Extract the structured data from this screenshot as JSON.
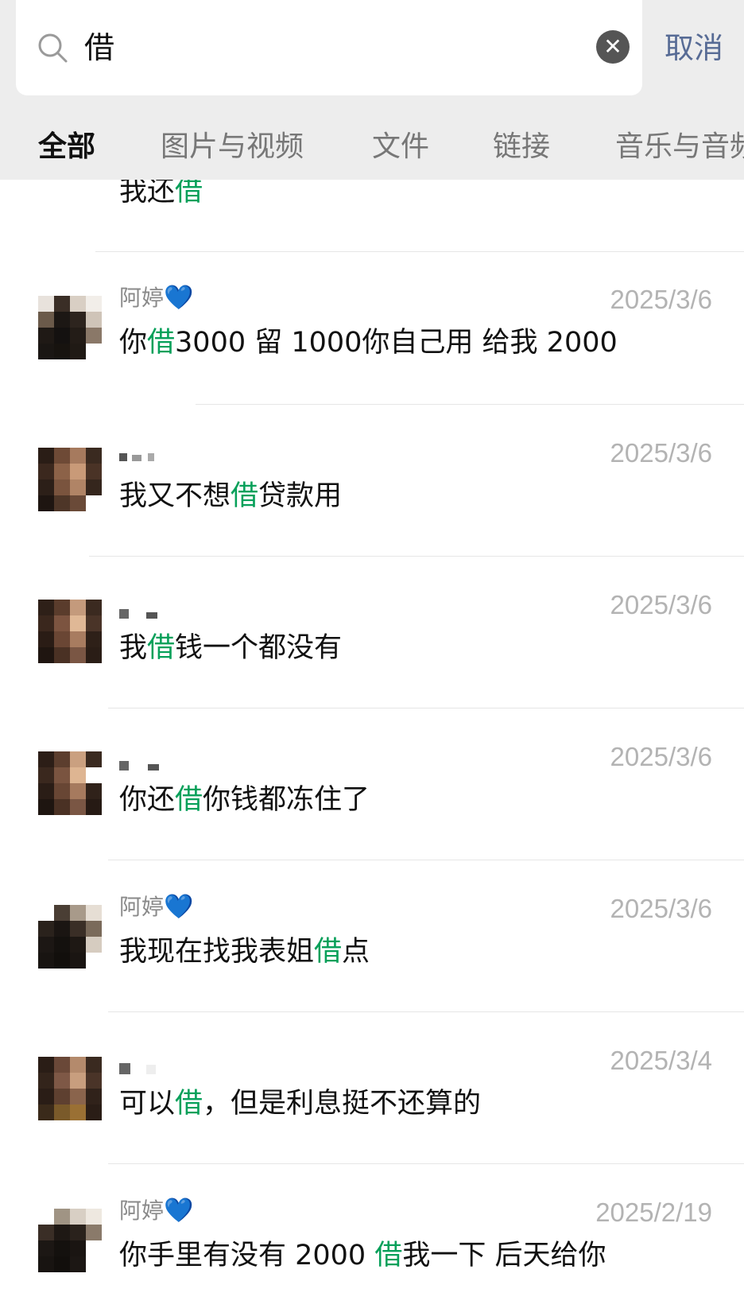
{
  "search": {
    "query": "借",
    "cancel_label": "取消"
  },
  "tabs": [
    {
      "label": "全部",
      "active": true
    },
    {
      "label": "图片与视频",
      "active": false
    },
    {
      "label": "文件",
      "active": false
    },
    {
      "label": "链接",
      "active": false
    },
    {
      "label": "音乐与音频",
      "active": false
    }
  ],
  "results": [
    {
      "name": "",
      "date": "",
      "msg_before": "我还",
      "msg_hl": "借",
      "msg_after": ""
    },
    {
      "name": "阿婷",
      "heart": "💙",
      "date": "2025/3/6",
      "msg_before": "你",
      "msg_hl": "借",
      "msg_after": "3000 留 1000你自己用 给我 2000"
    },
    {
      "name": "",
      "date": "2025/3/6",
      "msg_before": "我又不想",
      "msg_hl": "借",
      "msg_after": "贷款用"
    },
    {
      "name": "",
      "date": "2025/3/6",
      "msg_before": "我",
      "msg_hl": "借",
      "msg_after": "钱一个都没有"
    },
    {
      "name": "",
      "date": "2025/3/6",
      "msg_before": "你还",
      "msg_hl": "借",
      "msg_after": "你钱都冻住了"
    },
    {
      "name": "阿婷",
      "heart": "💙",
      "date": "2025/3/6",
      "msg_before": "我现在找我表姐",
      "msg_hl": "借",
      "msg_after": "点"
    },
    {
      "name": "",
      "date": "2025/3/4",
      "msg_before": "可以",
      "msg_hl": "借",
      "msg_after": "，但是利息挺不还算的"
    },
    {
      "name": "阿婷",
      "heart": "💙",
      "date": "2025/2/19",
      "msg_before": "你手里有没有 2000 ",
      "msg_hl": "借",
      "msg_after": "我一下 后天给你"
    }
  ],
  "colors": {
    "highlight": "#07a05a",
    "cancel": "#576b95",
    "heart": "#1e88e5"
  }
}
